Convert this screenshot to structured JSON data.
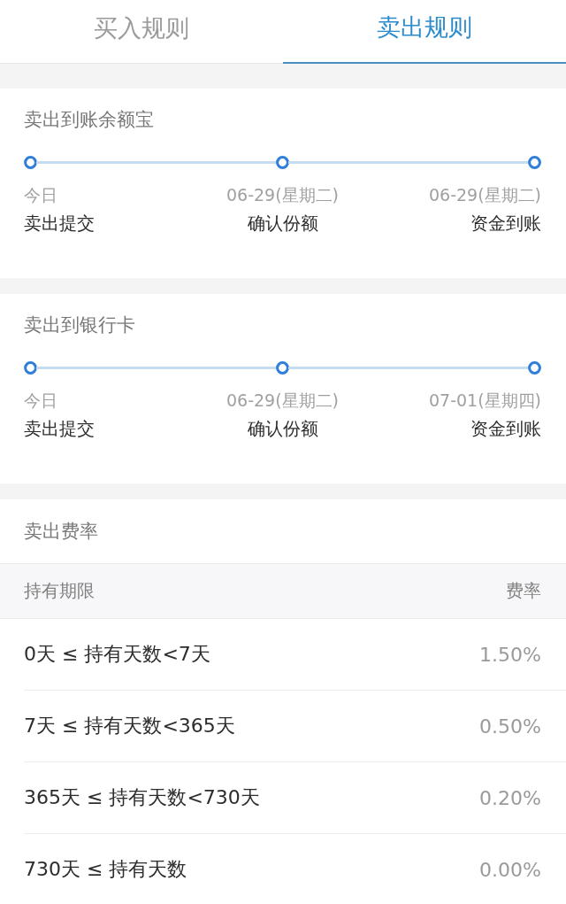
{
  "tabs": [
    {
      "label": "买入规则",
      "selected": false
    },
    {
      "label": "卖出规则",
      "selected": true
    }
  ],
  "sections": [
    {
      "kind": "timeline",
      "title": "卖出到账余额宝",
      "steps": [
        {
          "date": "今日",
          "label": "卖出提交"
        },
        {
          "date": "06-29(星期二)",
          "label": "确认份额"
        },
        {
          "date": "06-29(星期二)",
          "label": "资金到账"
        }
      ]
    },
    {
      "kind": "timeline",
      "title": "卖出到银行卡",
      "steps": [
        {
          "date": "今日",
          "label": "卖出提交"
        },
        {
          "date": "06-29(星期二)",
          "label": "确认份额"
        },
        {
          "date": "07-01(星期四)",
          "label": "资金到账"
        }
      ]
    },
    {
      "kind": "fee_table",
      "title": "卖出费率",
      "columns": [
        "持有期限",
        "费率"
      ],
      "rows": [
        [
          "0天 ≤ 持有天数<7天",
          "1.50%"
        ],
        [
          "7天 ≤ 持有天数<365天",
          "0.50%"
        ],
        [
          "365天 ≤ 持有天数<730天",
          "0.20%"
        ],
        [
          "730天 ≤ 持有天数",
          "0.00%"
        ]
      ]
    }
  ]
}
